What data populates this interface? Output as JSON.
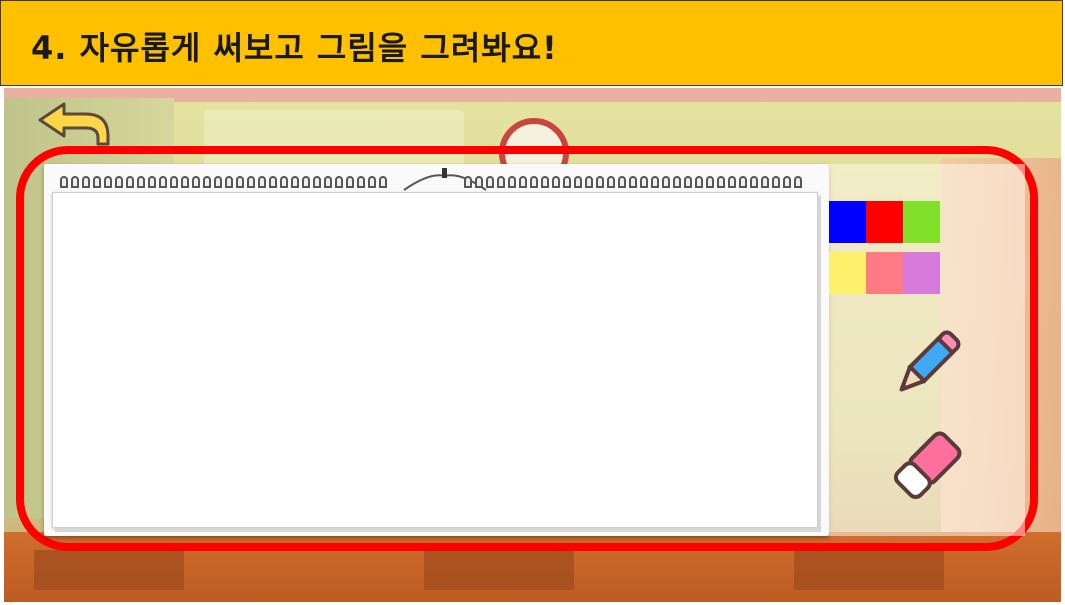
{
  "header": {
    "title": "4. 자유롭게 써보고 그림을 그려봐요!"
  },
  "palette": {
    "colors": [
      "#0000ff",
      "#ff0000",
      "#7fe12a",
      "#fdf06d",
      "#fd7b83",
      "#d879dc"
    ]
  },
  "tools": {
    "pencil_icon": "pencil-icon",
    "eraser_icon": "eraser-icon"
  },
  "icons": {
    "back": "back-arrow-icon"
  }
}
